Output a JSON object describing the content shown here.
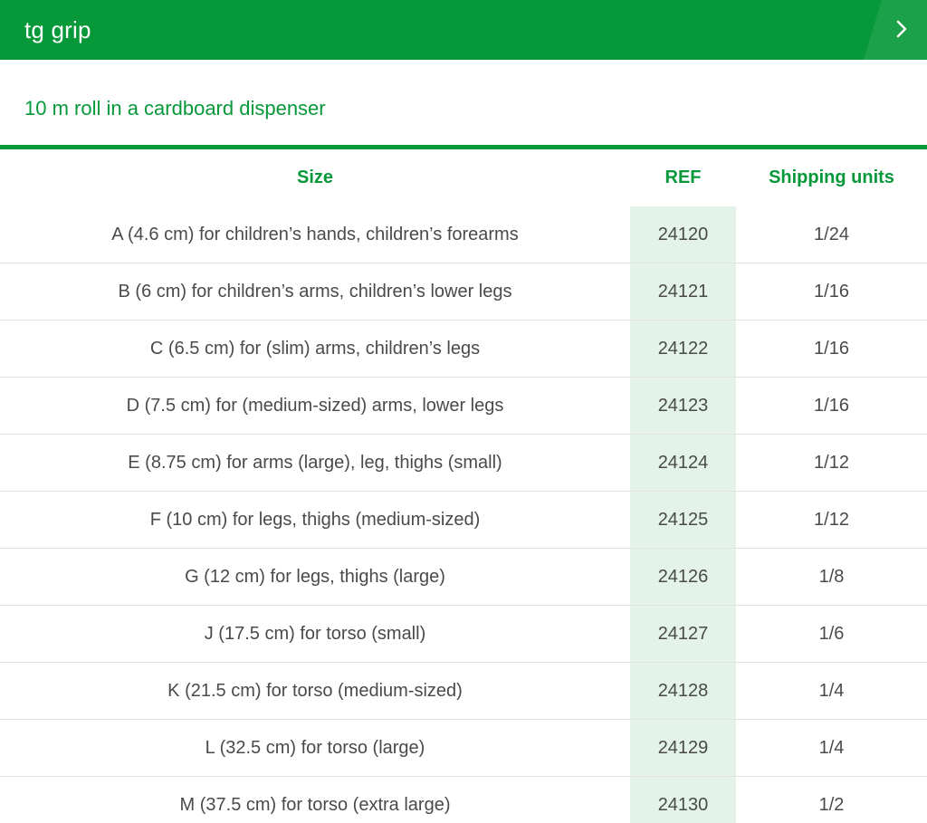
{
  "header": {
    "title": "tg grip",
    "arrow_icon": "chevron-right-icon",
    "colors": {
      "brand_green": "#079839",
      "arrow_zone": "#1aa14a"
    }
  },
  "subtitle": "10 m roll in a cardboard dispenser",
  "table": {
    "columns": [
      "Size",
      "REF",
      "Shipping units"
    ],
    "ref_column_highlight": "#e3f3e9",
    "rows": [
      {
        "size": "A (4.6 cm) for children’s hands, children’s forearms",
        "ref": "24120",
        "units": "1/24"
      },
      {
        "size": "B (6 cm) for children’s arms, children’s lower legs",
        "ref": "24121",
        "units": "1/16"
      },
      {
        "size": "C (6.5 cm) for (slim) arms, children’s legs",
        "ref": "24122",
        "units": "1/16"
      },
      {
        "size": "D (7.5 cm) for (medium-sized) arms, lower legs",
        "ref": "24123",
        "units": "1/16"
      },
      {
        "size": "E (8.75 cm) for arms (large), leg, thighs (small)",
        "ref": "24124",
        "units": "1/12"
      },
      {
        "size": "F (10 cm) for legs, thighs (medium-sized)",
        "ref": "24125",
        "units": "1/12"
      },
      {
        "size": "G (12 cm) for legs, thighs (large)",
        "ref": "24126",
        "units": "1/8"
      },
      {
        "size": "J (17.5 cm) for torso (small)",
        "ref": "24127",
        "units": "1/6"
      },
      {
        "size": "K (21.5 cm) for torso (medium-sized)",
        "ref": "24128",
        "units": "1/4"
      },
      {
        "size": "L (32.5 cm) for torso (large)",
        "ref": "24129",
        "units": "1/4"
      },
      {
        "size": "M (37.5 cm) for torso (extra large)",
        "ref": "24130",
        "units": "1/2"
      }
    ]
  }
}
